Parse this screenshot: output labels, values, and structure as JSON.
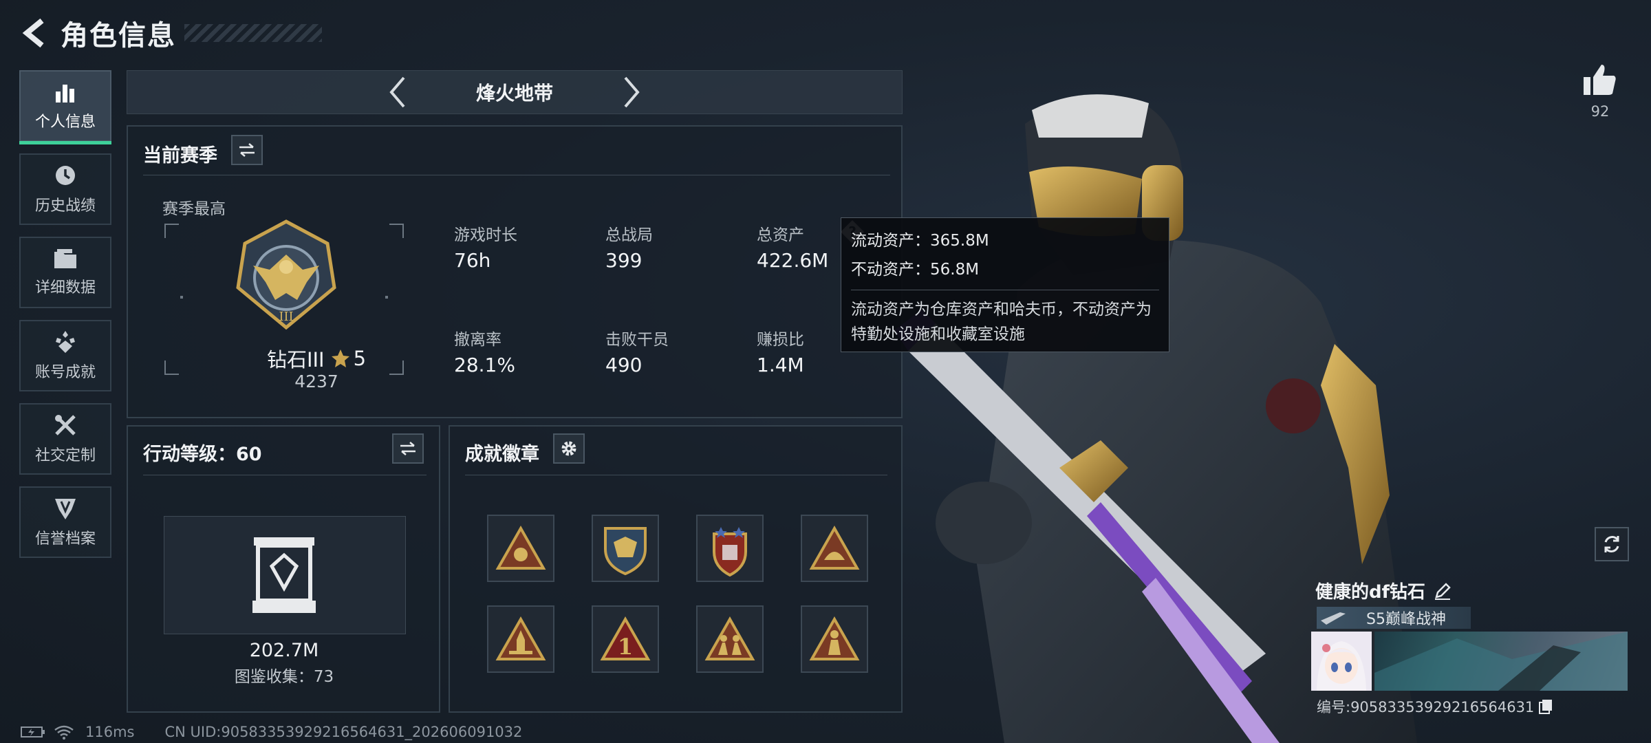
{
  "header": {
    "title": "角色信息"
  },
  "nav": {
    "items": [
      {
        "label": "个人信息",
        "icon": "bar-chart-icon",
        "active": true
      },
      {
        "label": "历史战绩",
        "icon": "history-clock-icon"
      },
      {
        "label": "详细数据",
        "icon": "folder-icon"
      },
      {
        "label": "账号成就",
        "icon": "achievement-icon"
      },
      {
        "label": "社交定制",
        "icon": "tools-icon"
      },
      {
        "label": "信誉档案",
        "icon": "reputation-icon"
      }
    ]
  },
  "mode": {
    "title": "烽火地带"
  },
  "season": {
    "title": "当前赛季",
    "best_label": "赛季最高",
    "rank_name": "钻石III",
    "rank_stars": "5",
    "rank_score": "4237",
    "stats": [
      {
        "label": "游戏时长",
        "value": "76h"
      },
      {
        "label": "总战局",
        "value": "399"
      },
      {
        "label": "总资产",
        "value": "422.6M"
      },
      {
        "label": "撤离率",
        "value": "28.1%"
      },
      {
        "label": "击败干员",
        "value": "490"
      },
      {
        "label": "赚损比",
        "value": "1.4M"
      }
    ]
  },
  "tooltip": {
    "liquid": "流动资产：365.8M",
    "fixed": "不动资产：56.8M",
    "desc": "流动资产为仓库资产和哈夫币，不动资产为特勤处设施和收藏室设施"
  },
  "action": {
    "title": "行动等级：60",
    "value": "202.7M",
    "collection": "图鉴收集：73"
  },
  "badges": {
    "title": "成就徽章",
    "items": [
      "triangle-crest-icon",
      "shield-crest-icon",
      "star-shield-icon",
      "triangle-helmet-icon",
      "triangle-rocket-icon",
      "triangle-number-one-icon",
      "triangle-soldiers-icon",
      "triangle-figure-icon"
    ]
  },
  "likes": {
    "count": "92"
  },
  "profile": {
    "name": "健康的df钻石",
    "title_tag": "S5巅峰战神",
    "id_text": "编号:9058335392921656463​1"
  },
  "status": {
    "ping": "116ms",
    "uid": "CN UID:9058335392921656463​1_202606091032"
  },
  "colors": {
    "accent": "#3ed19a",
    "gold": "#c9a34e"
  }
}
